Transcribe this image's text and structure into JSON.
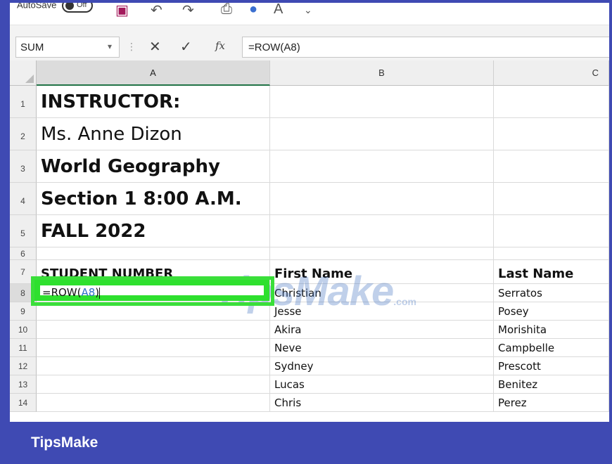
{
  "qat": {
    "autosave_label": "AutoSave",
    "autosave_state": "Off",
    "icons": [
      "save-icon",
      "undo-icon",
      "redo-icon",
      "quick-print-icon",
      "touch-mode-icon",
      "font-icon",
      "customize-qat-icon"
    ]
  },
  "formula_bar": {
    "name_box": "SUM",
    "cancel_glyph": "✕",
    "enter_glyph": "✓",
    "fx_label": "fx",
    "formula": "=ROW(A8)"
  },
  "columns": [
    "A",
    "B",
    "C"
  ],
  "rows": [
    {
      "num": "1",
      "a": "INSTRUCTOR:",
      "b": "",
      "c": ""
    },
    {
      "num": "2",
      "a": "Ms. Anne Dizon",
      "b": "",
      "c": ""
    },
    {
      "num": "3",
      "a": "World Geography",
      "b": "",
      "c": ""
    },
    {
      "num": "4",
      "a": "Section 1  8:00 A.M.",
      "b": "",
      "c": ""
    },
    {
      "num": "5",
      "a": "FALL 2022",
      "b": "",
      "c": ""
    },
    {
      "num": "6",
      "a": "",
      "b": "",
      "c": ""
    },
    {
      "num": "7",
      "a": "STUDENT NUMBER",
      "b": "First Name",
      "c": "Last Name"
    },
    {
      "num": "8",
      "a": "",
      "b": "Christian",
      "c": "Serratos"
    },
    {
      "num": "9",
      "a": "",
      "b": "Jesse",
      "c": "Posey"
    },
    {
      "num": "10",
      "a": "",
      "b": "Akira",
      "c": "Morishita"
    },
    {
      "num": "11",
      "a": "",
      "b": "Neve",
      "c": "Campbelle"
    },
    {
      "num": "12",
      "a": "",
      "b": "Sydney",
      "c": "Prescott"
    },
    {
      "num": "13",
      "a": "",
      "b": "Lucas",
      "c": "Benitez"
    },
    {
      "num": "14",
      "a": "",
      "b": "Chris",
      "c": "Perez"
    }
  ],
  "active_cell": {
    "ref": "A8",
    "edit_prefix": "=ROW(",
    "edit_ref": "A8",
    "edit_suffix": ")"
  },
  "watermark": {
    "text": "TipsMake",
    "suffix": ".com"
  },
  "footer": {
    "brand": "TipsMake"
  },
  "colors": {
    "frame": "#3f4ab3",
    "highlight": "#2ee02e",
    "ref_blue": "#2f6fc9"
  }
}
